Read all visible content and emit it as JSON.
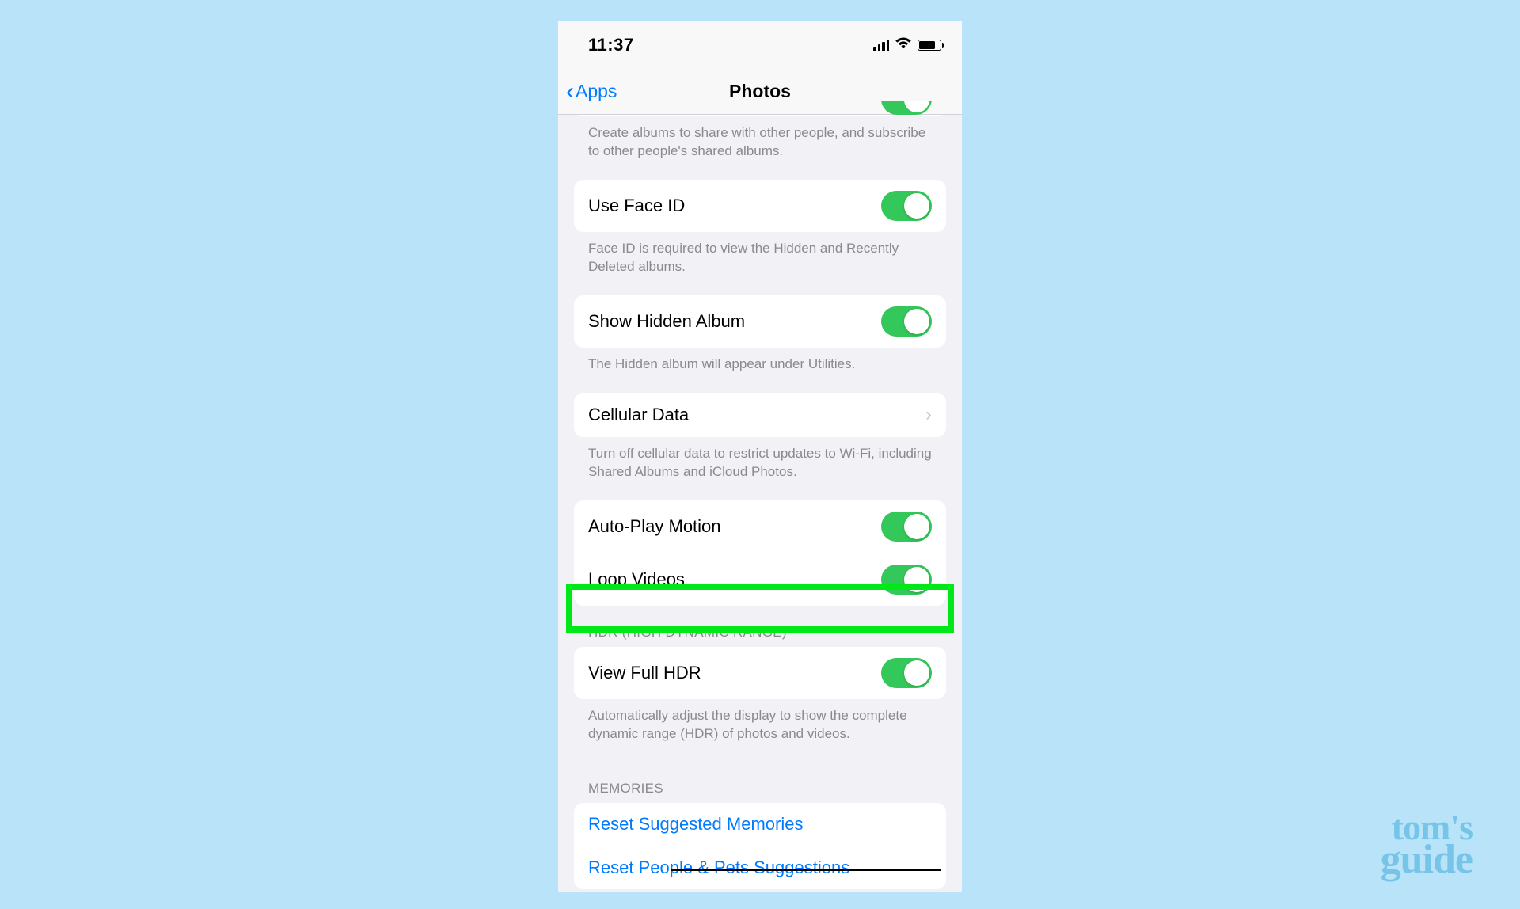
{
  "status": {
    "time": "11:37"
  },
  "nav": {
    "back": "Apps",
    "title": "Photos"
  },
  "rows": {
    "shared_desc": "Create albums to share with other people, and subscribe to other people's shared albums.",
    "face_id": "Use Face ID",
    "face_id_desc": "Face ID is required to view the Hidden and Recently Deleted albums.",
    "hidden": "Show Hidden Album",
    "hidden_desc": "The Hidden album will appear under Utilities.",
    "cellular": "Cellular Data",
    "cellular_desc": "Turn off cellular data to restrict updates to Wi-Fi, including Shared Albums and iCloud Photos.",
    "autoplay": "Auto-Play Motion",
    "loop": "Loop Videos",
    "hdr_header": "HDR (HIGH DYNAMIC RANGE)",
    "hdr": "View Full HDR",
    "hdr_desc": "Automatically adjust the display to show the complete dynamic range (HDR) of photos and videos.",
    "memories_header": "MEMORIES",
    "reset_mem": "Reset Suggested Memories",
    "reset_people": "Reset People & Pets Suggestions"
  },
  "watermark": {
    "line1": "tom's",
    "line2": "guide"
  },
  "toggles": {
    "shared_albums": true,
    "face_id": true,
    "hidden_album": true,
    "autoplay": true,
    "loop": true,
    "hdr": true
  },
  "colors": {
    "accent": "#007aff",
    "toggle_on": "#34c759",
    "highlight": "#00e818",
    "page_bg": "#b8e3f8"
  }
}
